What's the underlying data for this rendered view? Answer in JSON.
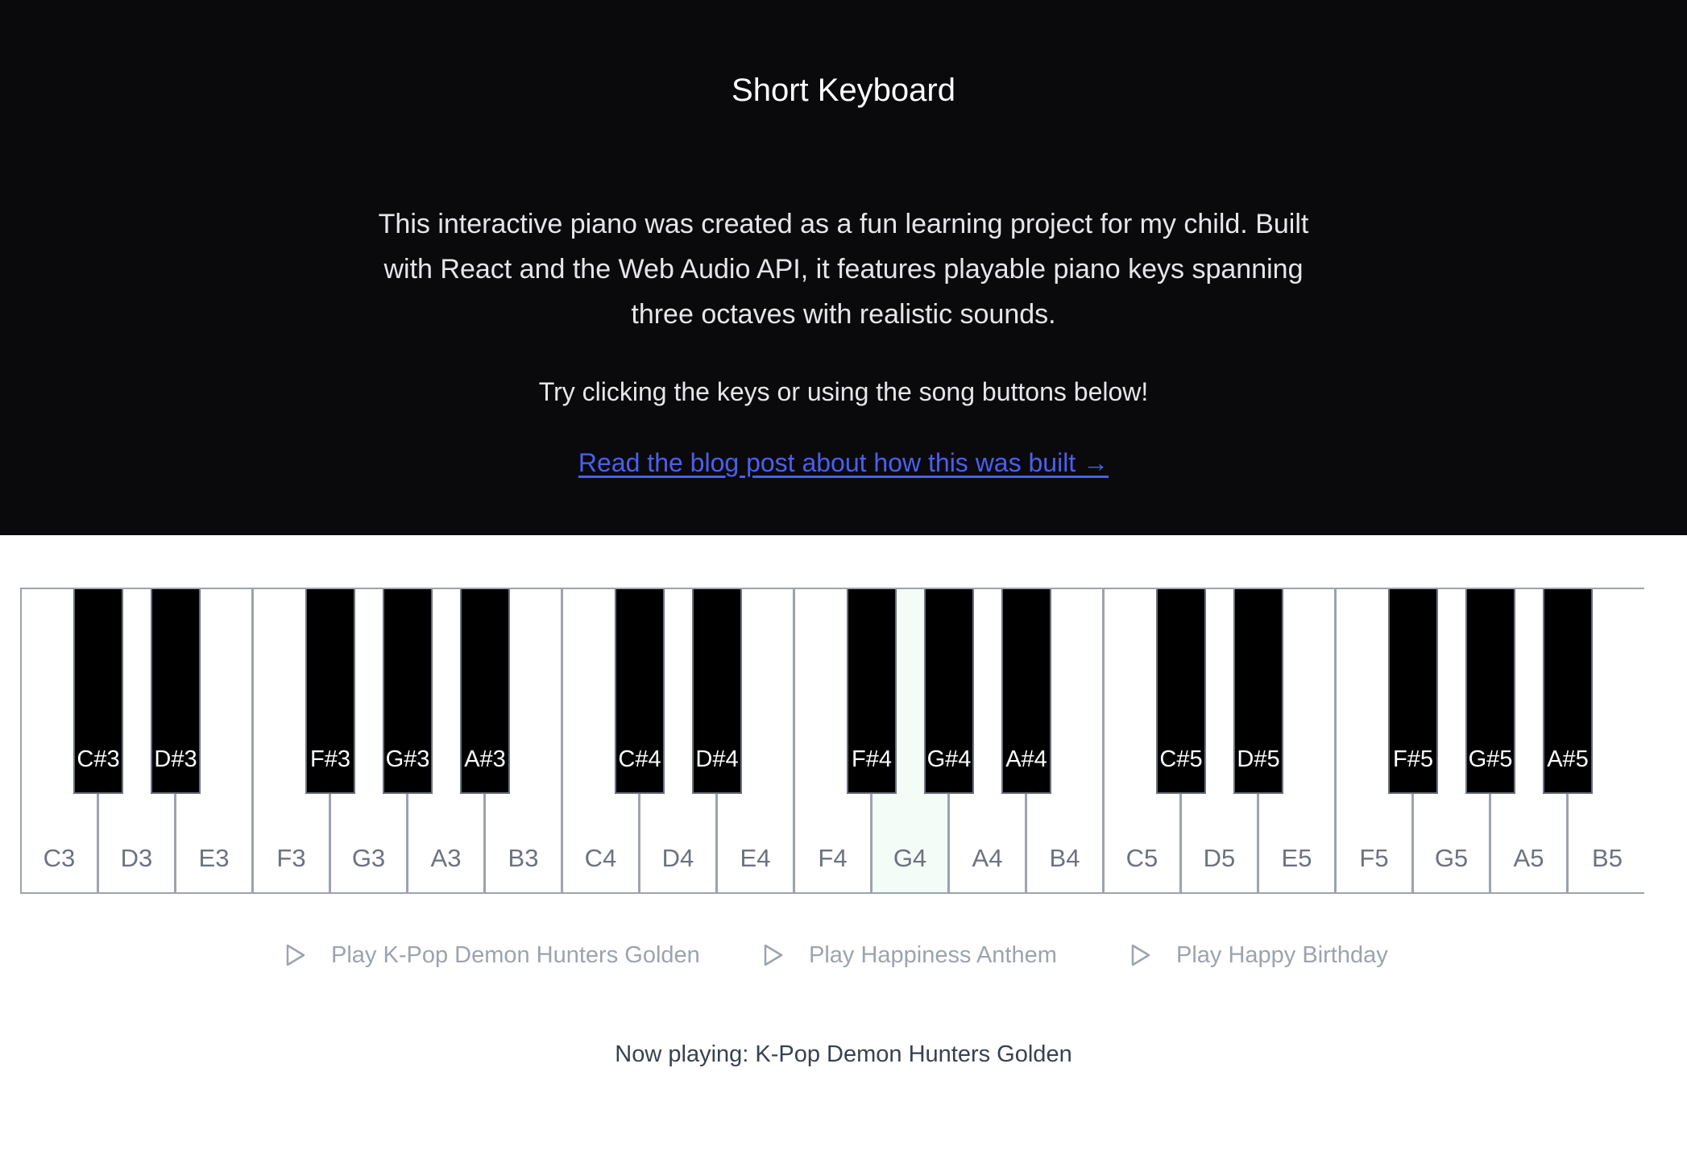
{
  "header": {
    "title": "Short Keyboard",
    "description": "This interactive piano was created as a fun learning project for my child. Built with React and the Web Audio API, it features playable piano keys spanning three octaves with realistic sounds.",
    "hint": "Try clicking the keys or using the song buttons below!",
    "blog_link": "Read the blog post about how this was built →"
  },
  "keyboard": {
    "active_key": "G4",
    "white_keys": [
      "C3",
      "D3",
      "E3",
      "F3",
      "G3",
      "A3",
      "B3",
      "C4",
      "D4",
      "E4",
      "F4",
      "G4",
      "A4",
      "B4",
      "C5",
      "D5",
      "E5",
      "F5",
      "G5",
      "A5",
      "B5"
    ],
    "black_keys": [
      "C#3",
      "D#3",
      "F#3",
      "G#3",
      "A#3",
      "C#4",
      "D#4",
      "F#4",
      "G#4",
      "A#4",
      "C#5",
      "D#5",
      "F#5",
      "G#5",
      "A#5"
    ]
  },
  "songs": [
    {
      "label": "Play K-Pop Demon Hunters Golden",
      "icon": "play-icon"
    },
    {
      "label": "Play Happiness Anthem",
      "icon": "play-icon"
    },
    {
      "label": "Play Happy Birthday",
      "icon": "play-icon"
    }
  ],
  "now_playing": "Now playing: K-Pop Demon Hunters Golden",
  "colors": {
    "header_bg": "#0a0a0d",
    "link": "#4a5ff0",
    "key_border": "#9ca3af",
    "active_key": "#f3fcf6"
  }
}
